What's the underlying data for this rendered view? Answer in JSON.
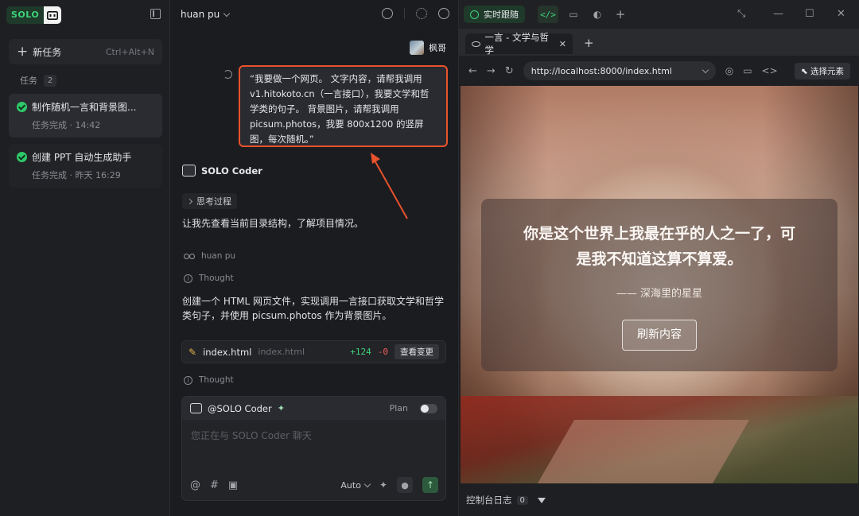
{
  "sidebar": {
    "brand": "SOLO",
    "new_task": {
      "label": "新任务",
      "shortcut": "Ctrl+Alt+N"
    },
    "tasks_label": "任务",
    "tasks_count": "2",
    "tasks": [
      {
        "title": "制作随机一言和背景图...",
        "meta": "任务完成 · 14:42"
      },
      {
        "title": "创建 PPT 自动生成助手",
        "meta": "任务完成 · 昨天 16:29"
      }
    ]
  },
  "chat": {
    "user": "huan pu",
    "sender_name": "枫哥",
    "message": "“我要做一个网页。 文字内容，请帮我调用 v1.hitokoto.cn（一言接口），我要文学和哲学类的句子。 背景图片，请帮我调用 picsum.photos，我要 800x1200 的竖屏图，每次随机。”",
    "coder_name": "SOLO Coder",
    "think_label": "思考过程",
    "text1": "让我先查看当前目录结构，了解项目情况。",
    "agent_user": "huan pu",
    "thought1": "Thought",
    "text2_line1": "创建一个 HTML 网页文件，实现调用一言接口获取文学和哲学",
    "text2_line2": "类句子，并使用 picsum.photos 作为背景图片。",
    "file": {
      "name": "index.html",
      "path": "index.html",
      "added": "+124",
      "removed": "-0",
      "view_label": "查看变更"
    },
    "thought2": "Thought",
    "composer": {
      "mention": "@SOLO Coder",
      "plan_label": "Plan",
      "placeholder": "您正在与 SOLO Coder 聊天",
      "mode": "Auto"
    }
  },
  "browser": {
    "live_tab": "实时跟随",
    "page_tab_title": "一言 - 文学与哲学",
    "url": "http://localhost:8000/index.html",
    "select_label": "选择元素",
    "quote_line1": "你是这个世界上我最在乎的人之一了，可",
    "quote_line2": "是我不知道这算不算爱。",
    "author": "—— 深海里的星星",
    "refresh_label": "刷新内容",
    "console_label": "控制台日志",
    "console_count": "0"
  },
  "colors": {
    "accent": "#3fd37a",
    "highlight": "#e8522c"
  }
}
